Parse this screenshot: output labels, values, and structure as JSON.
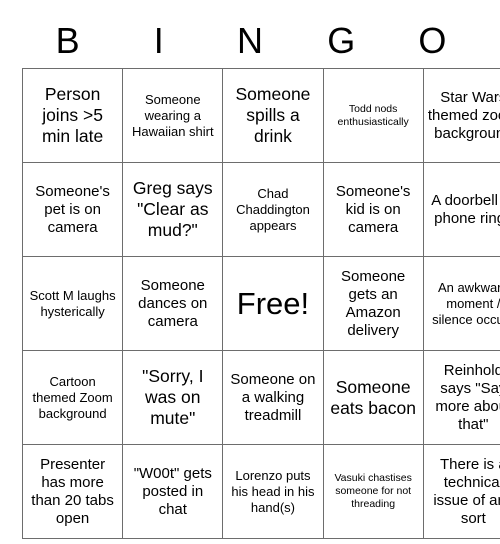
{
  "card": {
    "header_letters": [
      "B",
      "I",
      "N",
      "G",
      "O"
    ],
    "rows": [
      [
        {
          "text": "Person joins >5 min late",
          "size": "sz-lg"
        },
        {
          "text": "Someone wearing a Hawaiian shirt",
          "size": "sz-sm"
        },
        {
          "text": "Someone spills a drink",
          "size": "sz-lg"
        },
        {
          "text": "Todd nods enthusiastically",
          "size": "sz-xs"
        },
        {
          "text": "Star Wars themed zoom background",
          "size": "sz-md"
        }
      ],
      [
        {
          "text": "Someone's pet is on camera",
          "size": "sz-md"
        },
        {
          "text": "Greg says \"Clear as mud?\"",
          "size": "sz-lg"
        },
        {
          "text": "Chad Chaddington appears",
          "size": "sz-sm"
        },
        {
          "text": "Someone's kid is on camera",
          "size": "sz-md"
        },
        {
          "text": "A doorbell or phone rings",
          "size": "sz-md"
        }
      ],
      [
        {
          "text": "Scott M laughs hysterically",
          "size": "sz-sm"
        },
        {
          "text": "Someone dances on camera",
          "size": "sz-md"
        },
        {
          "text": "Free!",
          "size": "sz-free"
        },
        {
          "text": "Someone gets an Amazon delivery",
          "size": "sz-md"
        },
        {
          "text": "An awkward moment / silence occurs",
          "size": "sz-sm"
        }
      ],
      [
        {
          "text": "Cartoon themed Zoom background",
          "size": "sz-sm"
        },
        {
          "text": "\"Sorry, I was on mute\"",
          "size": "sz-lg"
        },
        {
          "text": "Someone on a walking treadmill",
          "size": "sz-md"
        },
        {
          "text": "Someone eats bacon",
          "size": "sz-lg"
        },
        {
          "text": "Reinhold says \"Say more about that\"",
          "size": "sz-md"
        }
      ],
      [
        {
          "text": "Presenter has more than 20 tabs open",
          "size": "sz-md"
        },
        {
          "text": "\"W00t\" gets posted in chat",
          "size": "sz-md"
        },
        {
          "text": "Lorenzo puts his head in his hand(s)",
          "size": "sz-sm"
        },
        {
          "text": "Vasuki chastises someone for not threading",
          "size": "sz-xs"
        },
        {
          "text": "There is a technical issue of any sort",
          "size": "sz-md"
        }
      ]
    ]
  },
  "colors": {
    "background": "#ffffff",
    "text": "#000000",
    "grid_line": "#6d6d6d"
  }
}
